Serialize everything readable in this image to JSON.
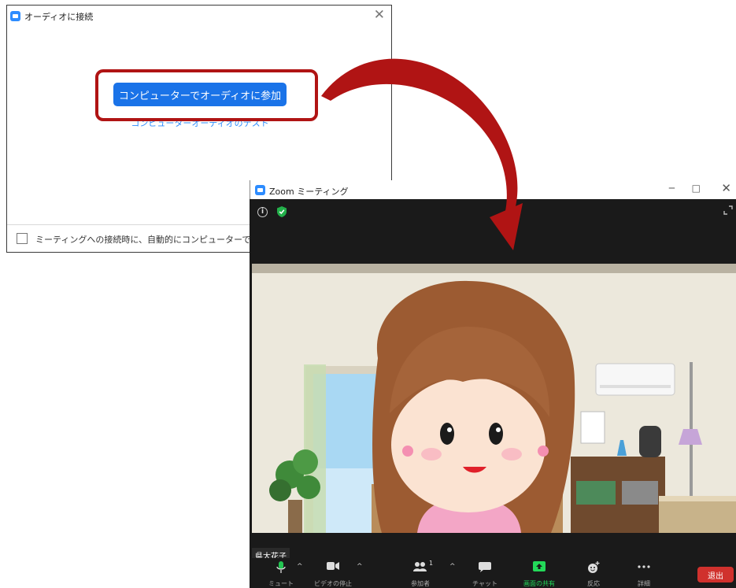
{
  "audio_dialog": {
    "title": "オーディオに接続",
    "close_glyph": "✕",
    "join_button_label": "コンピューターでオーディオに参加",
    "test_link_label": "コンピューターオーディオのテスト",
    "auto_join_label": "ミーティングへの接続時に、自動的にコンピューターでオーディオに参加"
  },
  "zoom_window": {
    "title": "Zoom ミーティング",
    "minimize_glyph": "─",
    "maximize_glyph": "□",
    "close_glyph": "✕",
    "info_glyph": "i",
    "participant_name": "県大花子",
    "toolbar": {
      "mute_label": "ミュート",
      "video_label": "ビデオの停止",
      "participants_label": "参加者",
      "participants_count": "1",
      "chat_label": "チャット",
      "share_label": "画面の共有",
      "reactions_label": "反応",
      "more_label": "詳細",
      "end_label": "退出",
      "caret_glyph": "^"
    }
  },
  "colors": {
    "zoom_blue": "#1a73e8",
    "highlight_red": "#b01414",
    "share_green": "#23d959",
    "end_red": "#d0312d"
  }
}
